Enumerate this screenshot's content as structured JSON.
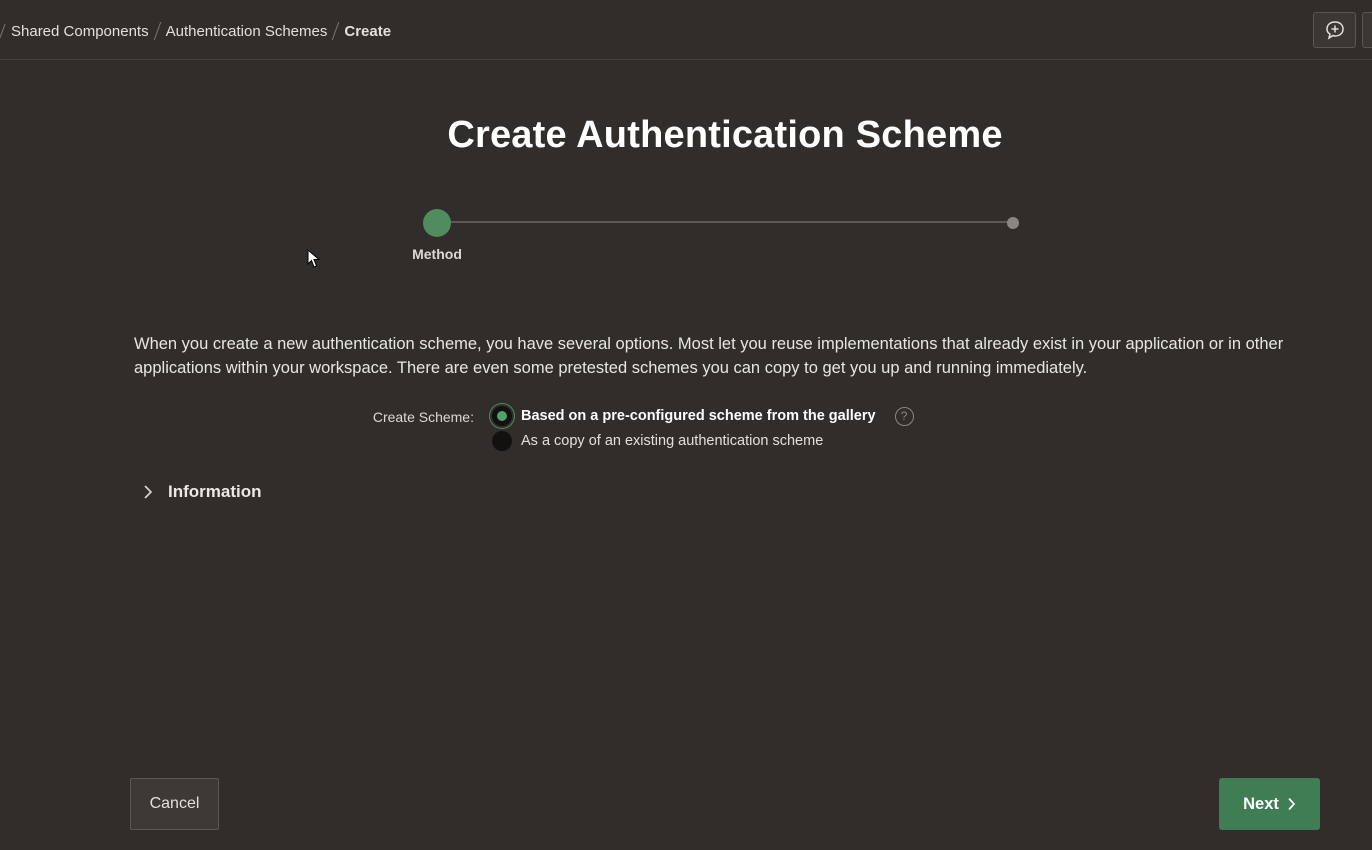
{
  "breadcrumb": {
    "items": [
      "Shared Components",
      "Authentication Schemes"
    ],
    "current": "Create"
  },
  "header": {
    "feedback_icon": "feedback-plus-icon"
  },
  "page": {
    "title": "Create Authentication Scheme"
  },
  "wizard": {
    "steps": [
      {
        "label": "Method",
        "state": "active"
      },
      {
        "label": "",
        "state": "pending"
      }
    ],
    "active_color": "#4f8c5e"
  },
  "body": {
    "description": "When you create a new authentication scheme, you have several options. Most let you reuse implementations that already exist in your application or in other applications within your workspace. There are even some pretested schemes you can copy to get you up and running immediately."
  },
  "form": {
    "create_scheme": {
      "label": "Create Scheme:",
      "options": [
        {
          "label": "Based on a pre-configured scheme from the gallery",
          "selected": true
        },
        {
          "label": "As a copy of an existing authentication scheme",
          "selected": false
        }
      ],
      "help_icon": "help-icon"
    }
  },
  "information": {
    "title": "Information",
    "expanded": false
  },
  "footer": {
    "cancel_label": "Cancel",
    "next_label": "Next"
  },
  "colors": {
    "background": "#312d2a",
    "primary": "#3f7d54"
  }
}
